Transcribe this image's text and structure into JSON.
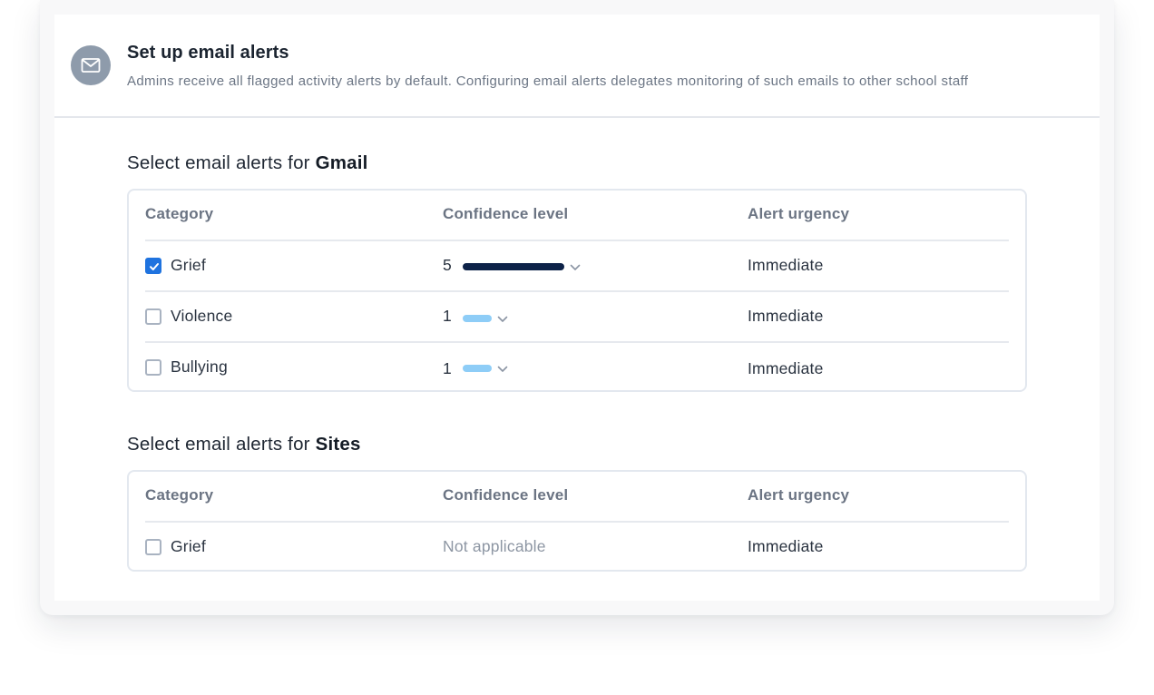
{
  "header": {
    "title": "Set up email alerts",
    "subtitle": "Admins receive all flagged activity alerts by default. Configuring email alerts delegates monitoring of such emails to other school staff",
    "icon": "mail-icon"
  },
  "columns": {
    "category": "Category",
    "confidence": "Confidence level",
    "urgency": "Alert urgency"
  },
  "gmail": {
    "title_prefix": "Select email alerts for ",
    "title_service": "Gmail",
    "rows": [
      {
        "category": "Grief",
        "checked": true,
        "confidence": "5",
        "level_fraction": 1.0,
        "bar_color": "#0d2248",
        "urgency": "Immediate"
      },
      {
        "category": "Violence",
        "checked": false,
        "confidence": "1",
        "level_fraction": 0.2,
        "bar_color": "#8ecdf7",
        "urgency": "Immediate"
      },
      {
        "category": "Bullying",
        "checked": false,
        "confidence": "1",
        "level_fraction": 0.2,
        "bar_color": "#8ecdf7",
        "urgency": "Immediate"
      }
    ]
  },
  "sites": {
    "title_prefix": "Select email alerts for ",
    "title_service": "Sites",
    "rows": [
      {
        "category": "Grief",
        "checked": false,
        "confidence": "Not applicable",
        "urgency": "Immediate"
      }
    ]
  },
  "colors": {
    "accent": "#1f73df",
    "badge": "#8e9bab",
    "bar_high": "#0d2248",
    "bar_low": "#8ecdf7"
  }
}
